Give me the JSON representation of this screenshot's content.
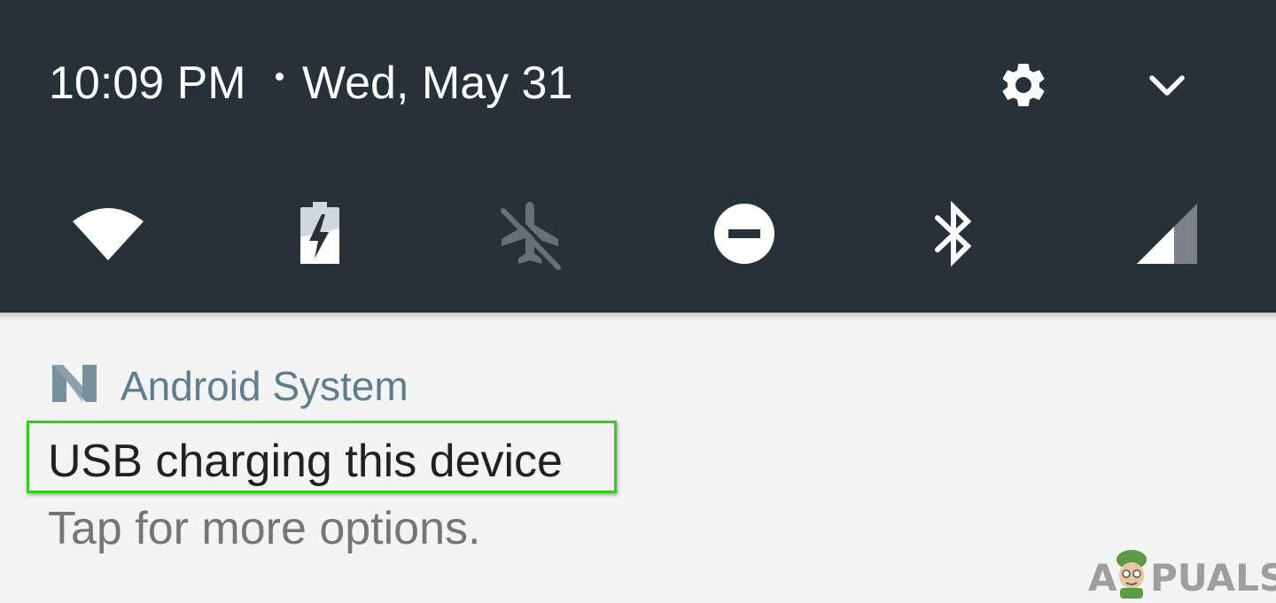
{
  "header": {
    "time": "10:09 PM",
    "date": "Wed, May 31",
    "settings_icon": "gear-icon",
    "expand_icon": "chevron-down-icon"
  },
  "quick_settings": [
    {
      "name": "wifi",
      "icon": "wifi-icon",
      "active": true
    },
    {
      "name": "battery",
      "icon": "battery-charging-icon",
      "active": true
    },
    {
      "name": "airplane-mode",
      "icon": "airplane-off-icon",
      "active": false
    },
    {
      "name": "do-not-disturb",
      "icon": "do-not-disturb-icon",
      "active": true
    },
    {
      "name": "bluetooth",
      "icon": "bluetooth-icon",
      "active": true
    },
    {
      "name": "cellular",
      "icon": "signal-icon",
      "active": true
    }
  ],
  "notification": {
    "app_name": "Android System",
    "app_icon": "android-n-icon",
    "title": "USB charging this device",
    "text": "Tap for more options."
  },
  "watermark": {
    "left": "A",
    "right": "PUALS"
  },
  "colors": {
    "shade_bg": "#263238",
    "panel_bg": "#f4f4f4",
    "app_name": "#607d8b",
    "highlight": "#2bd313"
  }
}
